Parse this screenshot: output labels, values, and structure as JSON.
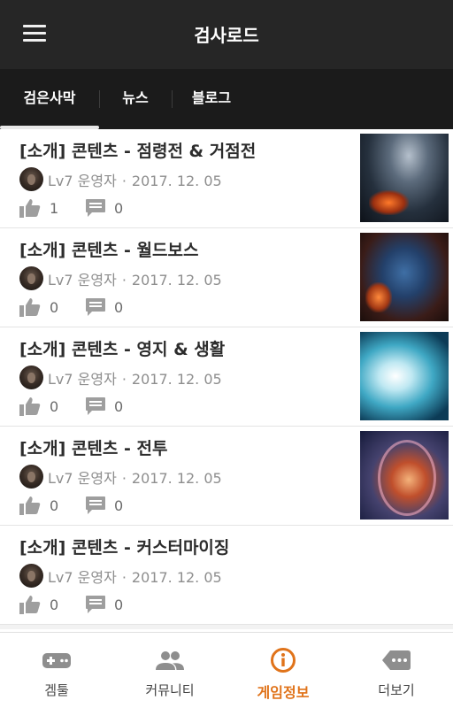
{
  "app": {
    "title": "검사로드"
  },
  "tabs": [
    "검은사막",
    "뉴스",
    "블로그"
  ],
  "posts": [
    {
      "title": "[소개] 콘텐츠 - 점령전 & 거점전",
      "level": "Lv7",
      "author": "운영자",
      "date": "2017. 12. 05",
      "likes": "1",
      "comments": "0",
      "has_thumb": true
    },
    {
      "title": "[소개] 콘텐츠 - 월드보스",
      "level": "Lv7",
      "author": "운영자",
      "date": "2017. 12. 05",
      "likes": "0",
      "comments": "0",
      "has_thumb": true
    },
    {
      "title": "[소개] 콘텐츠 - 영지 & 생활",
      "level": "Lv7",
      "author": "운영자",
      "date": "2017. 12. 05",
      "likes": "0",
      "comments": "0",
      "has_thumb": true
    },
    {
      "title": "[소개] 콘텐츠 - 전투",
      "level": "Lv7",
      "author": "운영자",
      "date": "2017. 12. 05",
      "likes": "0",
      "comments": "0",
      "has_thumb": true
    },
    {
      "title": "[소개] 콘텐츠 - 커스터마이징",
      "level": "Lv7",
      "author": "운영자",
      "date": "2017. 12. 05",
      "likes": "0",
      "comments": "0",
      "has_thumb": false
    }
  ],
  "meta_separator": "·",
  "bottom_nav": [
    {
      "label": "겜툴",
      "icon": "gamepad-icon",
      "active": false
    },
    {
      "label": "커뮤니티",
      "icon": "people-icon",
      "active": false
    },
    {
      "label": "게임정보",
      "icon": "info-icon",
      "active": true
    },
    {
      "label": "더보기",
      "icon": "more-icon",
      "active": false
    }
  ],
  "colors": {
    "appbar": "#262626",
    "tabbar": "#1b1b1b",
    "accent": "#e0731a",
    "icon_gray": "#9e9e9e"
  }
}
